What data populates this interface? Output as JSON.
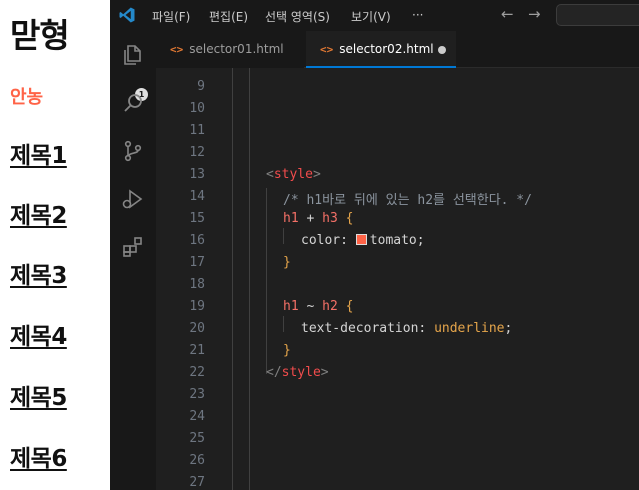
{
  "preview": {
    "h1": "맏형",
    "h3": "안농",
    "headings": [
      "제목1",
      "제목2",
      "제목3",
      "제목4",
      "제목5",
      "제목6"
    ]
  },
  "titlebar": {
    "menu": [
      "파일(F)",
      "편집(E)",
      "선택 영역(S)",
      "보기(V)",
      "···"
    ],
    "back_icon": "arrow-left-icon",
    "forward_icon": "arrow-right-icon"
  },
  "activity": {
    "explorer_badge": "1",
    "icons": [
      "files-icon",
      "search-icon",
      "source-control-icon",
      "run-debug-icon",
      "extensions-icon"
    ]
  },
  "tabs": [
    {
      "label": "selector01.html",
      "icon": "<>"
    },
    {
      "label": "selector02.html",
      "icon": "<>"
    }
  ],
  "editor": {
    "line_numbers": [
      "9",
      "10",
      "11",
      "12",
      "13",
      "14",
      "15",
      "16",
      "17",
      "18",
      "19",
      "20",
      "21",
      "22",
      "23",
      "24",
      "25",
      "26",
      "27"
    ],
    "code": {
      "l13_open": "<",
      "l13_tag": "style",
      "l13_close": ">",
      "l14_comment": "/* h1바로 뒤에 있는 h2를 선택한다. */",
      "l15_sel1": "h1",
      "l15_op": " + ",
      "l15_sel2": "h3",
      "l15_brace": " {",
      "l16_prop": "color: ",
      "l16_val": "tomato",
      "l16_semi": ";",
      "l17_brace": "}",
      "l19_sel1": "h1",
      "l19_op": " ~ ",
      "l19_sel2": "h2",
      "l19_brace": " {",
      "l20_prop": "text-decoration: ",
      "l20_val": "underline",
      "l20_semi": ";",
      "l21_brace": "}",
      "l22_open": "</",
      "l22_tag": "style",
      "l22_close": ">"
    },
    "swatch_color": "#ff6347"
  }
}
